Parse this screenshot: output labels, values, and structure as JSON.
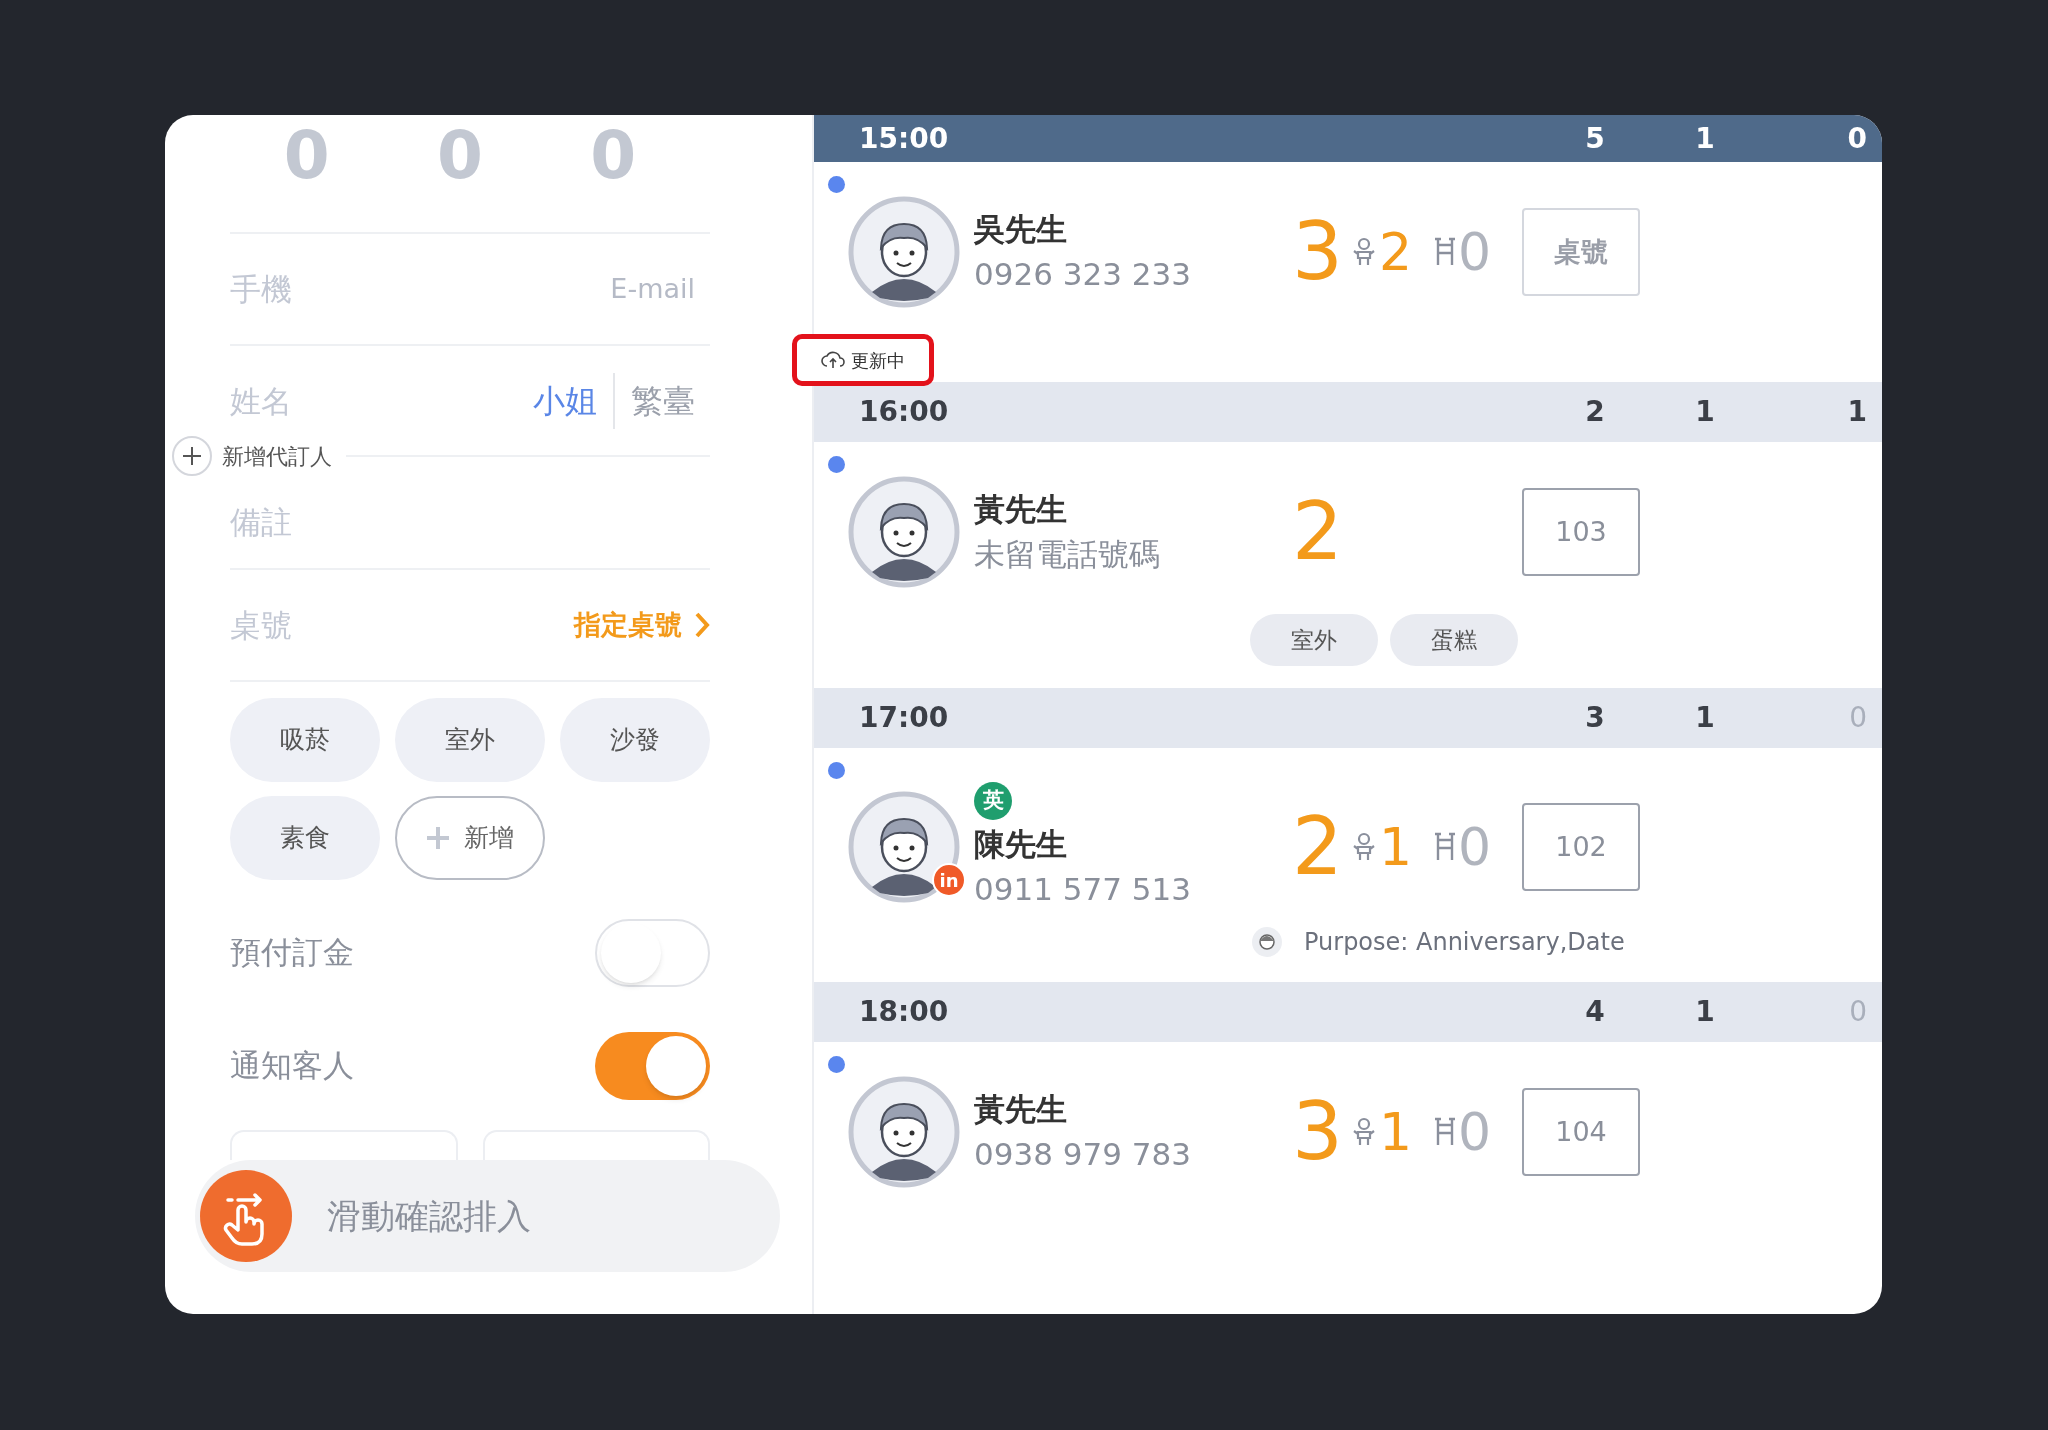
{
  "form": {
    "counters": [
      "0",
      "0",
      "0"
    ],
    "phone": {
      "placeholder": "手機"
    },
    "email": {
      "placeholder": "E-mail"
    },
    "name": {
      "placeholder": "姓名"
    },
    "name_options": [
      {
        "text": "小姐",
        "selected": true
      },
      {
        "text": "繁臺",
        "selected": false
      }
    ],
    "add_booker": "新增代訂人",
    "note": {
      "placeholder": "備註"
    },
    "table": {
      "label": "桌號",
      "action": "指定桌號"
    },
    "tags": [
      {
        "kind": "tag",
        "text": "吸菸"
      },
      {
        "kind": "tag",
        "text": "室外"
      },
      {
        "kind": "tag",
        "text": "沙發"
      },
      {
        "kind": "tag",
        "text": "素食"
      },
      {
        "kind": "add",
        "text": "新增"
      }
    ],
    "toggles": [
      {
        "label": "預付訂金",
        "on": false
      },
      {
        "label": "通知客人",
        "on": true
      }
    ],
    "slide_confirm": "滑動確認排入"
  },
  "schedule": [
    {
      "time": "15:00",
      "selected": true,
      "counts": [
        {
          "text": "5",
          "faded": false
        },
        {
          "text": "1",
          "faded": false
        },
        {
          "text": "0",
          "faded": false
        }
      ],
      "reservations": [
        {
          "name": "吳先生",
          "phone": "0926 323 233",
          "party": "3",
          "children": "2",
          "high_chairs": "0",
          "table": "桌號",
          "table_assigned": false
        }
      ],
      "status": "更新中"
    },
    {
      "time": "16:00",
      "selected": false,
      "counts": [
        {
          "text": "2",
          "faded": false
        },
        {
          "text": "1",
          "faded": false
        },
        {
          "text": "1",
          "faded": false
        }
      ],
      "reservations": [
        {
          "name": "黃先生",
          "phone": "未留電話號碼",
          "party": "2",
          "table": "103",
          "table_assigned": true,
          "tags": [
            "室外",
            "蛋糕"
          ]
        }
      ]
    },
    {
      "time": "17:00",
      "selected": false,
      "counts": [
        {
          "text": "3",
          "faded": false
        },
        {
          "text": "1",
          "faded": false
        },
        {
          "text": "0",
          "faded": true
        }
      ],
      "reservations": [
        {
          "name": "陳先生",
          "phone": "0911 577 513",
          "party": "2",
          "children": "1",
          "high_chairs": "0",
          "table": "102",
          "table_assigned": true,
          "language_badge": "英",
          "source_badge": "in",
          "purpose": "Purpose: Anniversary,Date"
        }
      ]
    },
    {
      "time": "18:00",
      "selected": false,
      "counts": [
        {
          "text": "4",
          "faded": false
        },
        {
          "text": "1",
          "faded": false
        },
        {
          "text": "0",
          "faded": true
        }
      ],
      "reservations": [
        {
          "name": "黃先生",
          "phone": "0938 979 783",
          "party": "3",
          "children": "1",
          "high_chairs": "0",
          "table": "104",
          "table_assigned": true
        }
      ]
    }
  ]
}
